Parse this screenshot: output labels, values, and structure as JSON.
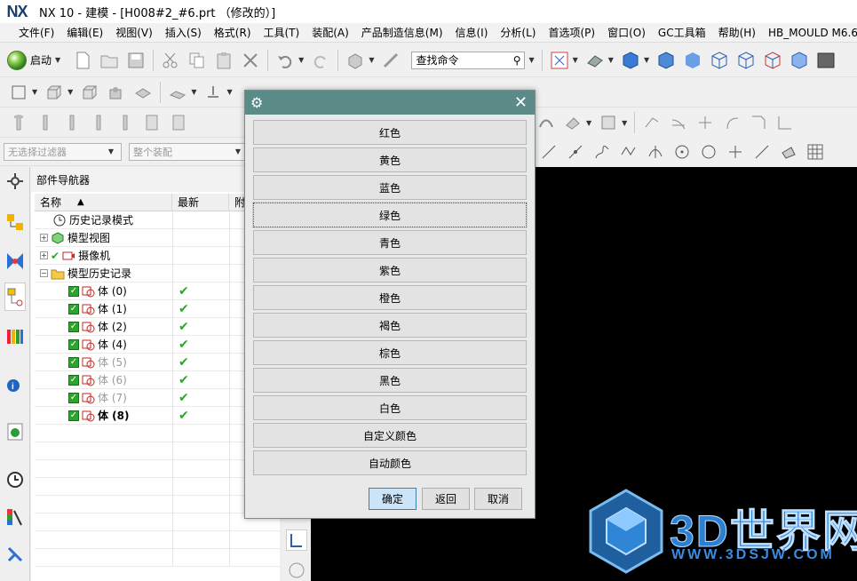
{
  "window": {
    "logo": "NX",
    "title": "NX 10 - 建模 - [H008#2_#6.prt （修改的）]"
  },
  "menu": [
    "文件(F)",
    "编辑(E)",
    "视图(V)",
    "插入(S)",
    "格式(R)",
    "工具(T)",
    "装配(A)",
    "产品制造信息(M)",
    "信息(I)",
    "分析(L)",
    "首选项(P)",
    "窗口(O)",
    "GC工具箱",
    "帮助(H)",
    "HB_MOULD M6.6"
  ],
  "toolbar": {
    "start_label": "启动",
    "search_placeholder": "查找命令"
  },
  "filters": {
    "selection_filter": "无选择过滤器",
    "assembly_scope": "整个装配"
  },
  "navigator": {
    "title": "部件导航器",
    "columns": {
      "name": "名称",
      "latest": "最新",
      "attached": "附"
    },
    "rows": [
      {
        "label": "历史记录模式"
      },
      {
        "label": "模型视图"
      },
      {
        "label": "摄像机"
      },
      {
        "label": "模型历史记录"
      },
      {
        "label": "体 (0)"
      },
      {
        "label": "体 (1)"
      },
      {
        "label": "体 (2)"
      },
      {
        "label": "体 (4)"
      },
      {
        "label": "体 (5)"
      },
      {
        "label": "体 (6)"
      },
      {
        "label": "体 (7)"
      },
      {
        "label": "体 (8)"
      }
    ]
  },
  "dialog": {
    "colors": [
      "红色",
      "黄色",
      "蓝色",
      "绿色",
      "青色",
      "紫色",
      "橙色",
      "褐色",
      "棕色",
      "黑色",
      "白色",
      "自定义颜色",
      "自动颜色"
    ],
    "ok": "确定",
    "back": "返回",
    "cancel": "取消"
  },
  "watermark": {
    "brand": "3D世界网",
    "url": "WWW.3DSJW.COM"
  },
  "colors": {
    "dialog_title_bg": "#5a8b87",
    "graphics_bg": "#000000",
    "check_green": "#2aa72a"
  }
}
